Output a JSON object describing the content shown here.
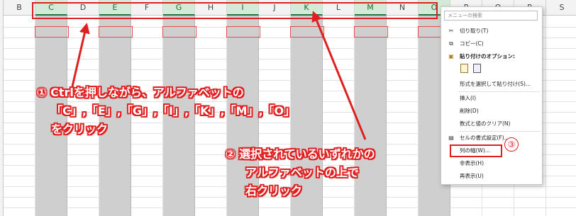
{
  "sheet": {
    "columns": [
      "B",
      "C",
      "D",
      "E",
      "F",
      "G",
      "H",
      "I",
      "J",
      "K",
      "L",
      "M",
      "N",
      "O",
      "P",
      "Q",
      "R",
      "S"
    ],
    "selected_columns": [
      "C",
      "E",
      "G",
      "I",
      "K",
      "M",
      "O"
    ]
  },
  "annotation1": {
    "line1": "① Ctrlを押しながら、アルファベットの",
    "line2": "「C」,「E」,「G」,「I」,「K」,「M」,「O」",
    "line3": "をクリック"
  },
  "annotation2": {
    "line1": "② 選択されているいずれかの",
    "line2": "アルファベットの上で",
    "line3": "右クリック"
  },
  "annotation3": {
    "label": "③"
  },
  "context_menu": {
    "search_placeholder": "メニューの検索",
    "items": [
      {
        "label": "切り取り(T)",
        "icon": "scissors-icon",
        "glyph": "✂"
      },
      {
        "label": "コピー(C)",
        "icon": "copy-icon",
        "glyph": "⧉"
      },
      {
        "label": "貼り付けのオプション:",
        "icon": "paste-options-icon",
        "glyph": "📋"
      },
      {
        "label": "形式を選択して貼り付け(S)...",
        "icon": "",
        "glyph": ""
      },
      {
        "label": "挿入(I)",
        "icon": "",
        "glyph": ""
      },
      {
        "label": "削除(D)",
        "icon": "",
        "glyph": ""
      },
      {
        "label": "数式と値のクリア(N)",
        "icon": "",
        "glyph": ""
      },
      {
        "label": "セルの書式設定(F)...",
        "icon": "format-cells-icon",
        "glyph": "▤"
      },
      {
        "label": "列の幅(W)...",
        "icon": "",
        "glyph": ""
      },
      {
        "label": "非表示(H)",
        "icon": "",
        "glyph": ""
      },
      {
        "label": "再表示(U)",
        "icon": "",
        "glyph": ""
      }
    ]
  },
  "colors": {
    "highlight": "#e02020",
    "selected_column": "#cfcfcf",
    "selected_header": "#d2ead6"
  }
}
